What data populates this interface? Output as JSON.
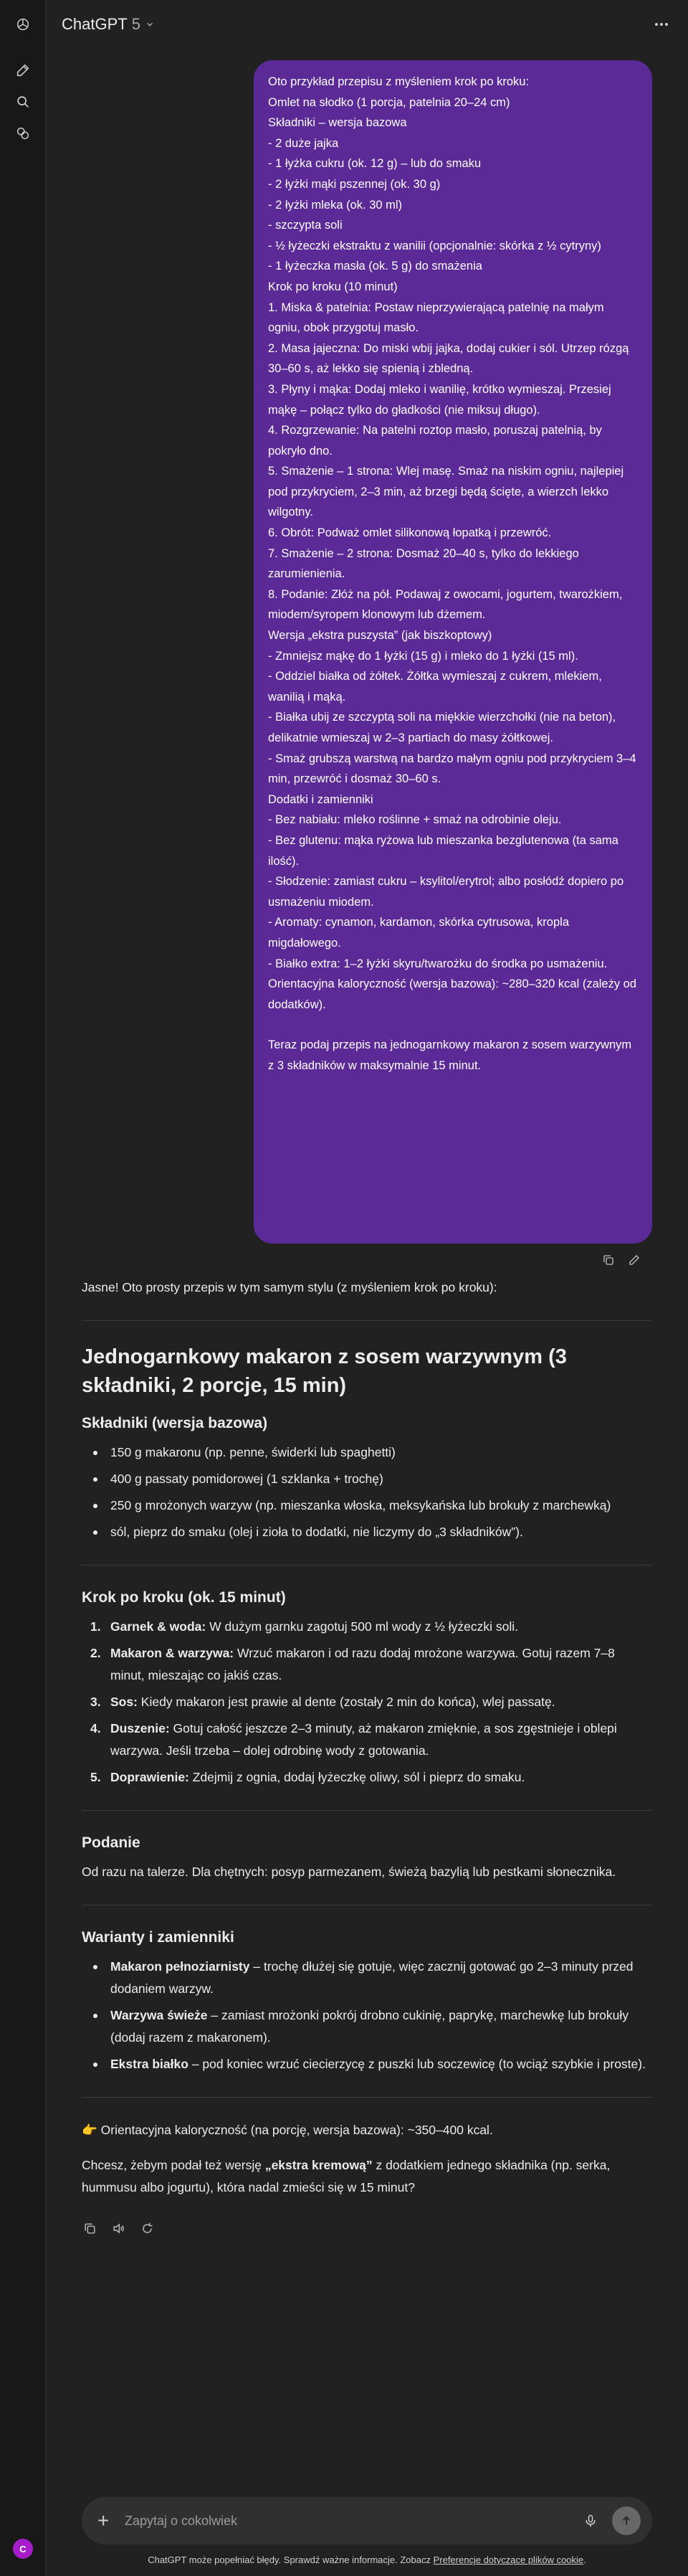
{
  "app": {
    "model_name": "ChatGPT",
    "model_version": "5",
    "avatar_initial": "C"
  },
  "user_message": {
    "lines": [
      "Oto przykład przepisu z myśleniem krok po kroku:",
      "Omlet na słodko (1 porcja, patelnia 20–24 cm)",
      "Składniki – wersja bazowa",
      "- 2 duże jajka",
      "- 1 łyżka cukru (ok. 12 g) – lub do smaku",
      "- 2 łyżki mąki pszennej (ok. 30 g)",
      "- 2 łyżki mleka (ok. 30 ml)",
      "- szczypta soli",
      "- ½ łyżeczki ekstraktu z wanilii (opcjonalnie: skórka z ½ cytryny)",
      "- 1 łyżeczka masła (ok. 5 g) do smażenia",
      "Krok po kroku (10 minut)",
      "1. Miska & patelnia: Postaw nieprzywierającą patelnię na małym ogniu, obok przygotuj masło.",
      "2. Masa jajeczna: Do miski wbij jajka, dodaj cukier i sól. Utrzep rózgą 30–60 s, aż lekko się spienią i zbledną.",
      "3. Płyny i mąka: Dodaj mleko i wanilię, krótko wymieszaj. Przesiej mąkę – połącz tylko do gładkości (nie miksuj długo).",
      "4. Rozgrzewanie: Na patelni roztop masło, poruszaj patelnią, by pokryło dno.",
      "5. Smażenie – 1 strona: Wlej masę. Smaż na niskim ogniu, najlepiej pod przykryciem, 2–3 min, aż brzegi będą ścięte, a wierzch lekko wilgotny.",
      "6. Obrót: Podważ omlet silikonową łopatką i przewróć.",
      "7. Smażenie – 2 strona: Dosmaż 20–40 s, tylko do lekkiego zarumienienia.",
      "8. Podanie: Złóż na pół. Podawaj z owocami, jogurtem, twarożkiem, miodem/syropem klonowym lub dżemem.",
      "Wersja „ekstra puszysta” (jak biszkoptowy)",
      "- Zmniejsz mąkę do 1 łyżki (15 g) i mleko do 1 łyżki (15 ml).",
      "- Oddziel białka od żółtek. Żółtka wymieszaj z cukrem, mlekiem, wanilią i mąką.",
      "- Białka ubij ze szczyptą soli na miękkie wierzchołki (nie na beton), delikatnie wmieszaj w 2–3 partiach do masy żółtkowej.",
      "- Smaż grubszą warstwą na bardzo małym ogniu pod przykryciem 3–4 min, przewróć i dosmaż 30–60 s.",
      "Dodatki i zamienniki",
      "- Bez nabiału: mleko roślinne + smaż na odrobinie oleju.",
      "- Bez glutenu: mąka ryżowa lub mieszanka bezglutenowa (ta sama ilość).",
      "- Słodzenie: zamiast cukru – ksylitol/erytrol; albo posłódź dopiero po usmażeniu miodem.",
      "- Aromaty: cynamon, kardamon, skórka cytrusowa, kropla migdałowego.",
      "- Białko extra: 1–2 łyżki skyru/twarożku do środka po usmażeniu.",
      "Orientacyjna kaloryczność (wersja bazowa): ~280–320 kcal (zależy od dodatków).",
      "",
      "Teraz podaj przepis na jednogarnkowy makaron z sosem warzywnym z 3 składników w maksymalnie 15 minut."
    ]
  },
  "assistant": {
    "intro": "Jasne! Oto prosty przepis w tym samym stylu (z myśleniem krok po kroku):",
    "title": "Jednogarnkowy makaron z sosem warzywnym (3 składniki, 2 porcje, 15 min)",
    "ingredients_heading": "Składniki (wersja bazowa)",
    "ingredients": [
      "150 g makaronu (np. penne, świderki lub spaghetti)",
      "400 g passaty pomidorowej (1 szklanka + trochę)",
      "250 g mrożonych warzyw (np. mieszanka włoska, meksykańska lub brokuły z marchewką)",
      "sól, pieprz do smaku (olej i zioła to dodatki, nie liczymy do „3 składników”)."
    ],
    "steps_heading": "Krok po kroku (ok. 15 minut)",
    "steps": [
      {
        "num": "1.",
        "label": "Garnek & woda:",
        "text": " W dużym garnku zagotuj 500 ml wody z ½ łyżeczki soli."
      },
      {
        "num": "2.",
        "label": "Makaron & warzywa:",
        "text": " Wrzuć makaron i od razu dodaj mrożone warzywa. Gotuj razem 7–8 minut, mieszając co jakiś czas."
      },
      {
        "num": "3.",
        "label": "Sos:",
        "text": " Kiedy makaron jest prawie al dente (zostały 2 min do końca), wlej passatę."
      },
      {
        "num": "4.",
        "label": "Duszenie:",
        "text": " Gotuj całość jeszcze 2–3 minuty, aż makaron zmięknie, a sos zgęstnieje i oblepi warzywa. Jeśli trzeba – dolej odrobinę wody z gotowania."
      },
      {
        "num": "5.",
        "label": "Doprawienie:",
        "text": " Zdejmij z ognia, dodaj łyżeczkę oliwy, sól i pieprz do smaku."
      }
    ],
    "serving_heading": "Podanie",
    "serving_text": "Od razu na talerze. Dla chętnych: posyp parmezanem, świeżą bazylią lub pestkami słonecznika.",
    "variants_heading": "Warianty i zamienniki",
    "variants": [
      {
        "label": "Makaron pełnoziarnisty",
        "text": " – trochę dłużej się gotuje, więc zacznij gotować go 2–3 minuty przed dodaniem warzyw."
      },
      {
        "label": "Warzywa świeże",
        "text": " – zamiast mrożonki pokrój drobno cukinię, paprykę, marchewkę lub brokuły (dodaj razem z makaronem)."
      },
      {
        "label": "Ekstra białko",
        "text": " – pod koniec wrzuć ciecierzycę z puszki lub soczewicę (to wciąż szybkie i proste)."
      }
    ],
    "calories_text": "👉 Orientacyjna kaloryczność (na porcję, wersja bazowa): ~350–400 kcal.",
    "followup_before": "Chcesz, żebym podał też wersję ",
    "followup_bold": "„ekstra kremową”",
    "followup_after": " z dodatkiem jednego składnika (np. serka, hummusu albo jogurtu), która nadal zmieści się w 15 minut?"
  },
  "composer": {
    "placeholder": "Zapytaj o cokolwiek"
  },
  "footer": {
    "text": "ChatGPT może popełniać błędy. Sprawdź ważne informacje. Zobacz ",
    "link": "Preferencje dotyczące plików cookie",
    "end": "."
  },
  "colors": {
    "background": "#212121",
    "user_bubble": "#5b2a96",
    "avatar": "#a61ec9"
  }
}
